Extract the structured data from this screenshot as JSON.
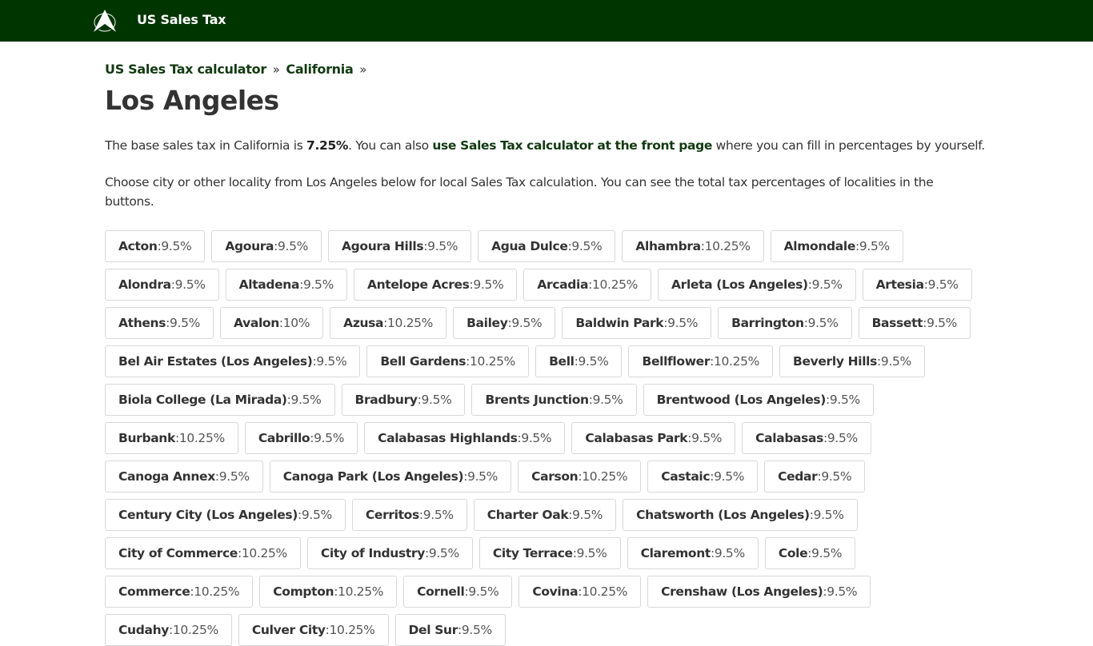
{
  "header": {
    "logo_icon": "compass-a-logo-icon",
    "brand": "US Sales Tax",
    "brand_color": "#013500"
  },
  "breadcrumb": {
    "items": [
      "US Sales Tax calculator",
      "California"
    ],
    "separator": "»"
  },
  "page_title": "Los Angeles",
  "intro": {
    "text_1": "The base sales tax in California is ",
    "base_rate": "7.25%",
    "text_2": ". You can also ",
    "link": "use Sales Tax calculator at the front page",
    "text_3": " where you can fill in percentages by yourself."
  },
  "choose_text": "Choose city or other locality from Los Angeles below for local Sales Tax calculation. You can see the total tax percentages of localities in the buttons.",
  "localities": [
    {
      "name": "Acton",
      "rate": "9.5%"
    },
    {
      "name": "Agoura",
      "rate": "9.5%"
    },
    {
      "name": "Agoura Hills",
      "rate": "9.5%"
    },
    {
      "name": "Agua Dulce",
      "rate": "9.5%"
    },
    {
      "name": "Alhambra",
      "rate": "10.25%"
    },
    {
      "name": "Almondale",
      "rate": "9.5%"
    },
    {
      "name": "Alondra",
      "rate": "9.5%"
    },
    {
      "name": "Altadena",
      "rate": "9.5%"
    },
    {
      "name": "Antelope Acres",
      "rate": "9.5%"
    },
    {
      "name": "Arcadia",
      "rate": "10.25%"
    },
    {
      "name": "Arleta (Los Angeles)",
      "rate": "9.5%"
    },
    {
      "name": "Artesia",
      "rate": "9.5%"
    },
    {
      "name": "Athens",
      "rate": "9.5%"
    },
    {
      "name": "Avalon",
      "rate": "10%"
    },
    {
      "name": "Azusa",
      "rate": "10.25%"
    },
    {
      "name": "Bailey",
      "rate": "9.5%"
    },
    {
      "name": "Baldwin Park",
      "rate": "9.5%"
    },
    {
      "name": "Barrington",
      "rate": "9.5%"
    },
    {
      "name": "Bassett",
      "rate": "9.5%"
    },
    {
      "name": "Bel Air Estates (Los Angeles)",
      "rate": "9.5%"
    },
    {
      "name": "Bell Gardens",
      "rate": "10.25%"
    },
    {
      "name": "Bell",
      "rate": "9.5%"
    },
    {
      "name": "Bellflower",
      "rate": "10.25%"
    },
    {
      "name": "Beverly Hills",
      "rate": "9.5%"
    },
    {
      "name": "Biola College (La Mirada)",
      "rate": "9.5%"
    },
    {
      "name": "Bradbury",
      "rate": "9.5%"
    },
    {
      "name": "Brents Junction",
      "rate": "9.5%"
    },
    {
      "name": "Brentwood (Los Angeles)",
      "rate": "9.5%"
    },
    {
      "name": "Burbank",
      "rate": "10.25%"
    },
    {
      "name": "Cabrillo",
      "rate": "9.5%"
    },
    {
      "name": "Calabasas Highlands",
      "rate": "9.5%"
    },
    {
      "name": "Calabasas Park",
      "rate": "9.5%"
    },
    {
      "name": "Calabasas",
      "rate": "9.5%"
    },
    {
      "name": "Canoga Annex",
      "rate": "9.5%"
    },
    {
      "name": "Canoga Park (Los Angeles)",
      "rate": "9.5%"
    },
    {
      "name": "Carson",
      "rate": "10.25%"
    },
    {
      "name": "Castaic",
      "rate": "9.5%"
    },
    {
      "name": "Cedar",
      "rate": "9.5%"
    },
    {
      "name": "Century City (Los Angeles)",
      "rate": "9.5%"
    },
    {
      "name": "Cerritos",
      "rate": "9.5%"
    },
    {
      "name": "Charter Oak",
      "rate": "9.5%"
    },
    {
      "name": "Chatsworth (Los Angeles)",
      "rate": "9.5%"
    },
    {
      "name": "City of Commerce",
      "rate": "10.25%"
    },
    {
      "name": "City of Industry",
      "rate": "9.5%"
    },
    {
      "name": "City Terrace",
      "rate": "9.5%"
    },
    {
      "name": "Claremont",
      "rate": "9.5%"
    },
    {
      "name": "Cole",
      "rate": "9.5%"
    },
    {
      "name": "Commerce",
      "rate": "10.25%"
    },
    {
      "name": "Compton",
      "rate": "10.25%"
    },
    {
      "name": "Cornell",
      "rate": "9.5%"
    },
    {
      "name": "Covina",
      "rate": "10.25%"
    },
    {
      "name": "Crenshaw (Los Angeles)",
      "rate": "9.5%"
    },
    {
      "name": "Cudahy",
      "rate": "10.25%"
    },
    {
      "name": "Culver City",
      "rate": "10.25%"
    },
    {
      "name": "Del Sur",
      "rate": "9.5%"
    }
  ]
}
